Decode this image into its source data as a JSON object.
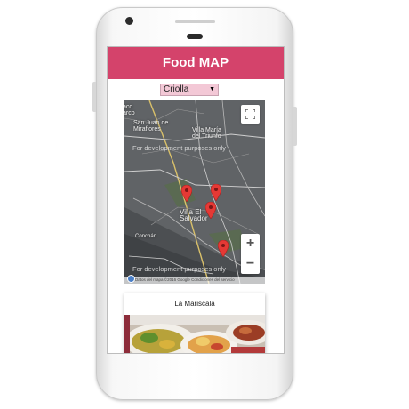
{
  "app": {
    "title": "Food MAP"
  },
  "filter": {
    "selected": "Criolla"
  },
  "map": {
    "labels": [
      "aco\narco",
      "San Juan de\nMiraflores",
      "Villa María\ndel Triunfo",
      "Villa El\nSalvador",
      "Conchán"
    ],
    "dev_notice": "For development purposes only",
    "zoom_in": "+",
    "zoom_out": "−",
    "attribution": "Datos del mapa ©2016 Google    Condiciones del servicio",
    "markers": 4
  },
  "card": {
    "title": "La Mariscala"
  },
  "colors": {
    "header": "#d4436b",
    "select_bg": "#f3c8d6",
    "pin": "#e53935"
  },
  "icons": [
    "camera-icon",
    "fullscreen-icon",
    "map-marker-icon",
    "google-logo-icon",
    "chevron-down-icon"
  ]
}
